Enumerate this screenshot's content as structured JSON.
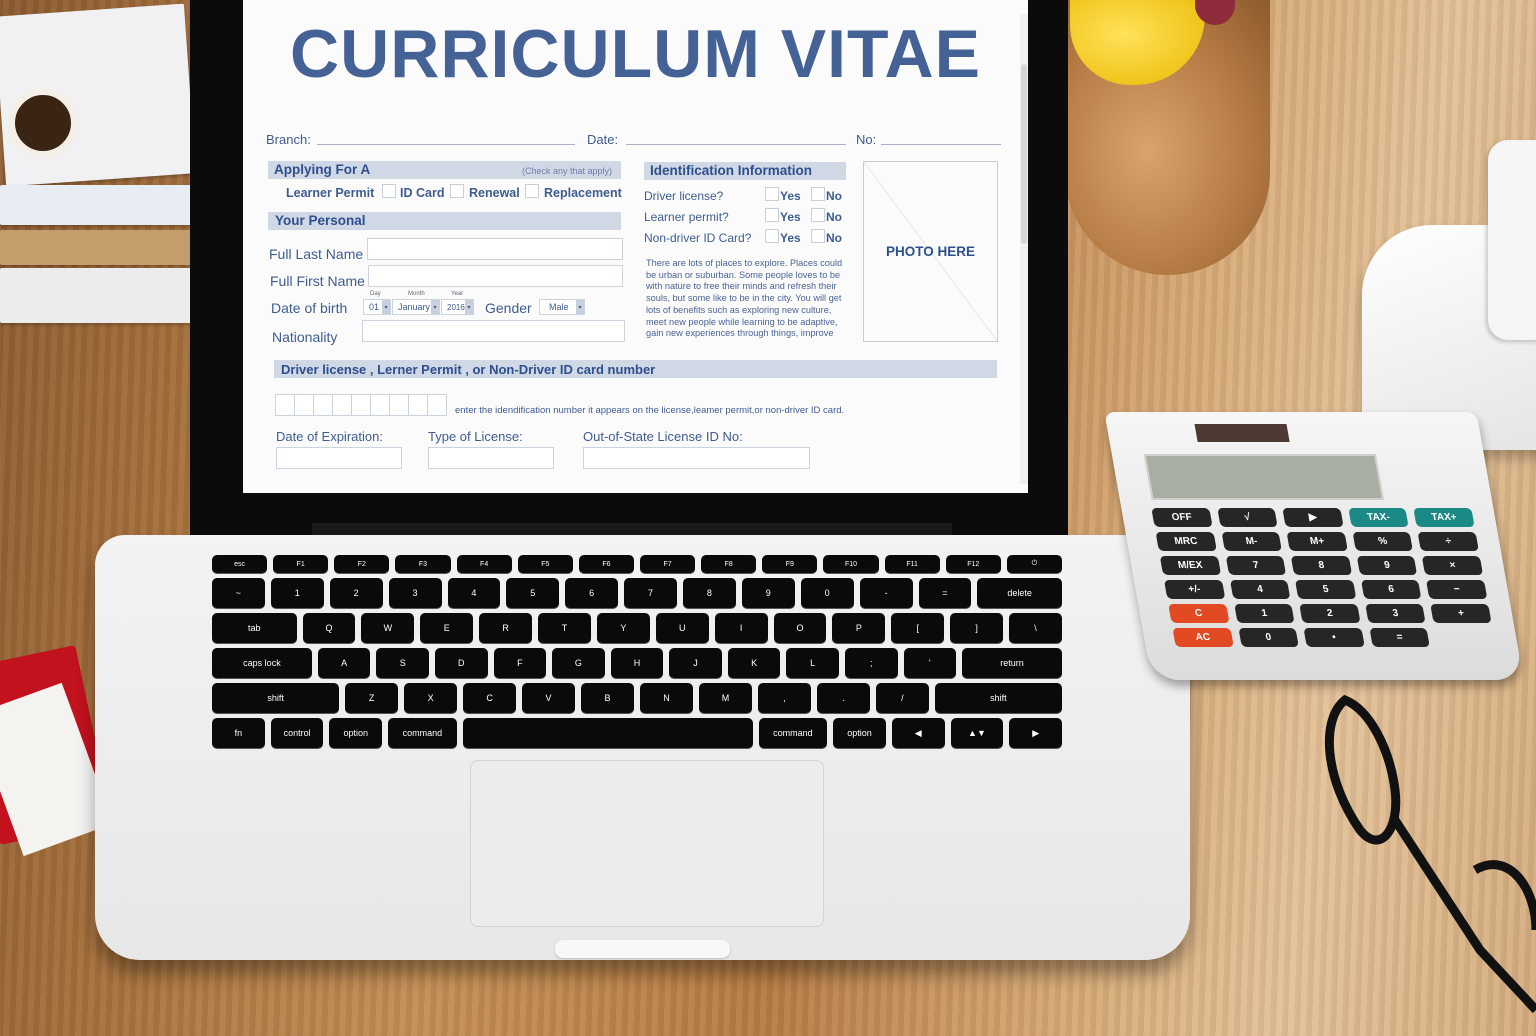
{
  "form": {
    "title": "CURRICULUM VITAE",
    "header_fields": {
      "branch_label": "Branch:",
      "date_label": "Date:",
      "no_label": "No:"
    },
    "applying_section": {
      "heading": "Applying For A",
      "hint": "(Check any that apply)",
      "options": [
        {
          "label": "Learner Permit",
          "checked": false
        },
        {
          "label": "ID Card",
          "checked": false
        },
        {
          "label": "Renewal",
          "checked": false
        },
        {
          "label": "Replacement",
          "checked": false
        }
      ]
    },
    "personal_section": {
      "heading": "Your Personal",
      "full_last_name_label": "Full Last Name",
      "full_last_name_value": "",
      "full_first_name_label": "Full First Name",
      "full_first_name_value": "",
      "dob_label": "Date of birth",
      "day_caption": "Day",
      "day_value": "01",
      "month_caption": "Month",
      "month_value": "January",
      "year_caption": "Year",
      "year_value": "2016",
      "gender_label": "Gender",
      "gender_value": "Male",
      "nationality_label": "Nationality",
      "nationality_value": ""
    },
    "identification_section": {
      "heading": "Identification Information",
      "questions": [
        {
          "label": "Driver license?",
          "yes": "Yes",
          "no": "No"
        },
        {
          "label": "Learner permit?",
          "yes": "Yes",
          "no": "No"
        },
        {
          "label": "Non-driver ID Card?",
          "yes": "Yes",
          "no": "No"
        }
      ],
      "paragraph": "There are lots of places to explore. Places could be urban or suburban. Some people loves to be with nature to free their minds and refresh their souls, but some like to be in the city. You will get lots of benefits such as exploring new culture, meet new people while learning to be adaptive, gain new experiences through things, improve"
    },
    "photo_placeholder": "PHOTO HERE",
    "license_section": {
      "heading": "Driver license , Lerner Permit , or Non-Driver ID card number",
      "id_box_count": 9,
      "instruction": "enter the idendification number it appears on the license,leamer permit,or non-driver ID card.",
      "expiration_label": "Date of Expiration:",
      "type_label": "Type of License:",
      "out_of_state_label": "Out-of-State License ID No:"
    }
  },
  "keyboard": {
    "function_row": [
      "esc",
      "F1",
      "F2",
      "F3",
      "F4",
      "F5",
      "F6",
      "F7",
      "F8",
      "F9",
      "F10",
      "F11",
      "F12",
      "⏻"
    ],
    "row1": [
      "~",
      "1",
      "2",
      "3",
      "4",
      "5",
      "6",
      "7",
      "8",
      "9",
      "0",
      "-",
      "=",
      "delete"
    ],
    "row2": [
      "tab",
      "Q",
      "W",
      "E",
      "R",
      "T",
      "Y",
      "U",
      "I",
      "O",
      "P",
      "[",
      "]",
      "\\"
    ],
    "row3": [
      "caps lock",
      "A",
      "S",
      "D",
      "F",
      "G",
      "H",
      "J",
      "K",
      "L",
      ";",
      "'",
      "return"
    ],
    "row4": [
      "shift",
      "Z",
      "X",
      "C",
      "V",
      "B",
      "N",
      "M",
      ",",
      ".",
      "/",
      "shift"
    ],
    "row5": [
      "fn",
      "control",
      "option",
      "command",
      "",
      "command",
      "option",
      "◀",
      "▲▼",
      "▶"
    ]
  },
  "calculator": {
    "keys": [
      "OFF",
      "√",
      "▶",
      "TAX-",
      "TAX+",
      "MRC",
      "M-",
      "M+",
      "%",
      "÷",
      "M/EX",
      "7",
      "8",
      "9",
      "×",
      "+/-",
      "4",
      "5",
      "6",
      "−",
      "C",
      "1",
      "2",
      "3",
      "+",
      "AC",
      "0",
      "•",
      "=",
      ""
    ]
  },
  "colors": {
    "title_blue": "#456296",
    "label_blue": "#3f5c91",
    "band_fill": "#d0d8e6"
  }
}
